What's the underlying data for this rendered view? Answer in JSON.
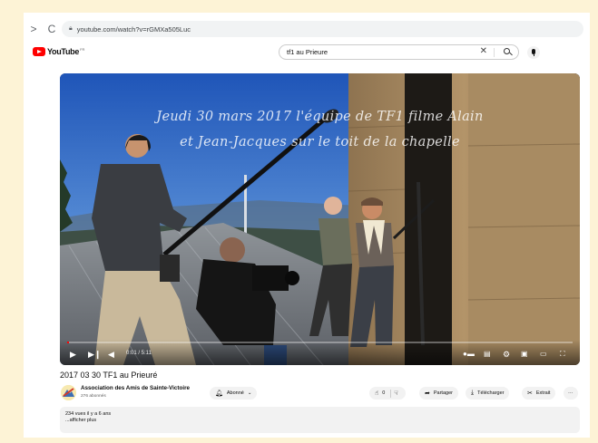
{
  "browser": {
    "back_glyph": ">",
    "reload_glyph": "C",
    "lock_icon": "lock-icon",
    "url": "youtube.com/watch?v=rGMXa505Luc"
  },
  "youtube": {
    "logo_text": "YouTube",
    "logo_region": "FR",
    "search_value": "tf1 au Prieure"
  },
  "video": {
    "caption_line1": "Jeudi 30 mars 2017 l'équipe de TF1  filme Alain",
    "caption_line2": "et Jean-Jacques sur le toit de la chapelle",
    "time": "0:01 / 5:11",
    "progress": 0.004
  },
  "meta": {
    "title": "2017 03 30 TF1 au Prieuré",
    "channel_name": "Association des Amis de Sainte-Victoire",
    "subscribers": "276 abonnés",
    "subscribed_label": "Abonné",
    "likes": "0",
    "share_label": "Partager",
    "download_label": "Télécharger",
    "clip_label": "Extrait",
    "more_label": "···",
    "views_line": "234 vues  il y a 6 ans",
    "show_more": "...afficher plus"
  },
  "colors": {
    "page_background": "#fdf3d6",
    "brand_red": "#ff0000"
  }
}
